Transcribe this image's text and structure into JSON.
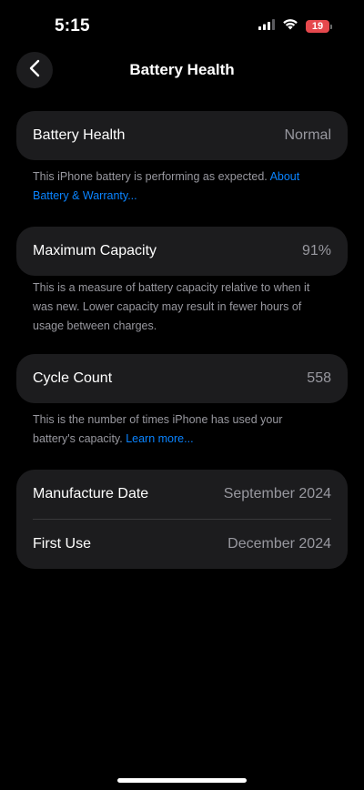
{
  "status_bar": {
    "time": "5:15",
    "battery_level": "19",
    "battery_color": "#e5484d",
    "icons": [
      "cellular-signal-icon",
      "wifi-icon",
      "battery-icon"
    ]
  },
  "nav": {
    "back_icon": "chevron-left-icon",
    "title": "Battery Health"
  },
  "sections": {
    "battery_health": {
      "label": "Battery Health",
      "value": "Normal",
      "footnote_text": "This iPhone battery is performing as expected. ",
      "footnote_link": "About Battery & Warranty..."
    },
    "maximum_capacity": {
      "label": "Maximum Capacity",
      "value": "91%",
      "footnote_text": "This is a measure of battery capacity relative to when it was new. Lower capacity may result in fewer hours of usage between charges."
    },
    "cycle_count": {
      "label": "Cycle Count",
      "value": "558",
      "footnote_text": "This is the number of times iPhone has used your battery's capacity. ",
      "footnote_link": "Learn more..."
    },
    "dates": {
      "manufacture_label": "Manufacture Date",
      "manufacture_value": "September 2024",
      "first_use_label": "First Use",
      "first_use_value": "December 2024"
    }
  },
  "colors": {
    "background": "#000000",
    "card": "#1c1c1e",
    "secondary_text": "#98989f",
    "link": "#0a84ff"
  }
}
